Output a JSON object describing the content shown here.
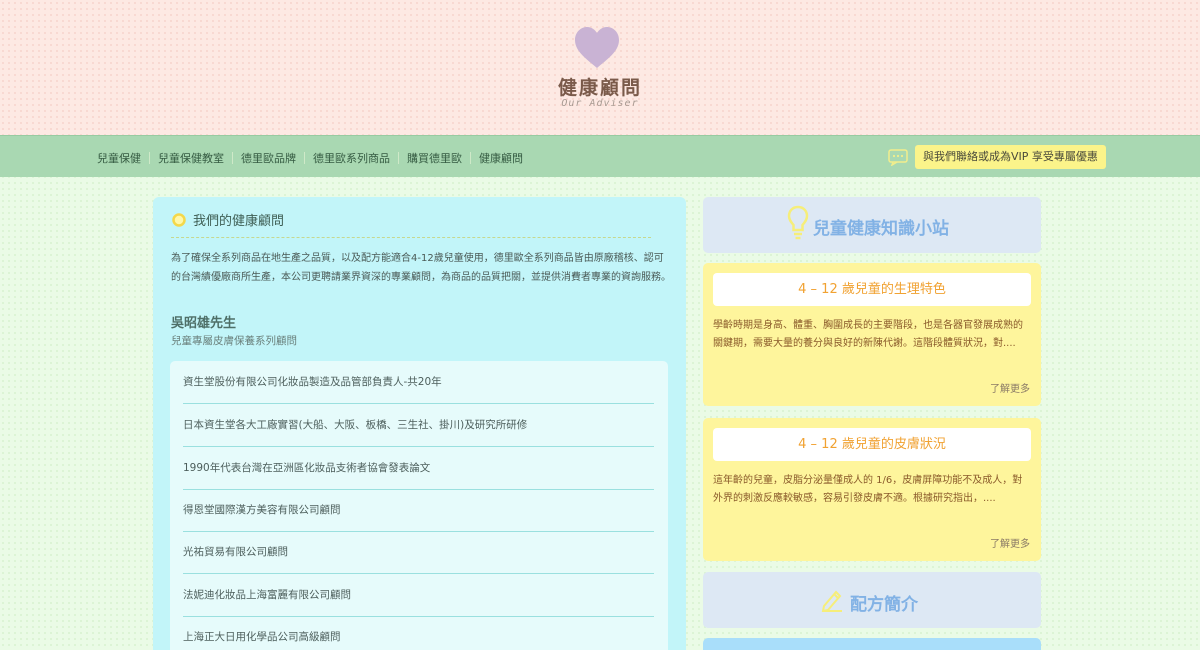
{
  "header": {
    "logo_icon": "heart-icon",
    "logo_color": "#c9b3d4",
    "title": "健康顧問",
    "subtitle": "Our Adviser"
  },
  "nav": {
    "items": [
      "兒童保健",
      "兒童保健教室",
      "德里歐品牌",
      "德里歐系列商品",
      "購買德里歐",
      "健康顧問"
    ],
    "chat_icon": "chat-bubble-icon",
    "vip_label": "與我們聯絡或成為VIP 享受專屬優惠"
  },
  "adviser": {
    "heading": "我們的健康顧問",
    "heading_icon": "yellow-circle-bullet-icon",
    "intro": "為了確保全系列商品在地生產之品質，以及配方能適合4-12歲兒童使用，德里歐全系列商品皆由原廠稽核、認可的台灣績優廠商所生產，本公司更聘請業界資深的專業顧問，為商品的品質把關，並提供消費者專業的資詢服務。",
    "name": "吳昭雄先生",
    "role": "兒童專屬皮膚保養系列顧問",
    "career": [
      "資生堂股份有限公司化妝品製造及品管部負責人-共20年",
      "日本資生堂各大工廠實習(大船、大阪、板橋、三生社、掛川)及研究所研修",
      "1990年代表台灣在亞洲區化妝品支術者協會發表論文",
      "得恩堂國際漢方美容有限公司顧問",
      "光祐貿易有限公司顧問",
      "法妮迪化妝品上海富麗有限公司顧問",
      "上海正大日用化學品公司高級顧問"
    ]
  },
  "knowledge": {
    "title": "兒童健康知識小站",
    "icon": "lightbulb-icon",
    "articles": [
      {
        "title": "4 – 12 歲兒童的生理特色",
        "excerpt": "學齡時期是身高、體重、胸圍成長的主要階段，也是各器官發展成熟的關鍵期，需要大量的養分與良好的新陳代謝。這階段體質狀況，對....",
        "more": "了解更多"
      },
      {
        "title": "4 – 12 歲兒童的皮膚狀況",
        "excerpt": "這年齡的兒童，皮脂分泌量僅成人的 1/6，皮膚屏障功能不及成人，對外界的刺激反應較敏感，容易引發皮膚不適。根據研究指出，....",
        "more": "了解更多"
      }
    ]
  },
  "formula": {
    "title": "配方簡介",
    "icon": "pencil-icon"
  },
  "colors": {
    "header_bg": "#fde9e3",
    "nav_bg": "#a9d8b2",
    "vip_bg": "#fbf48a",
    "left_panel_bg": "#c2f5f9",
    "card_bg": "#fef59c",
    "accent_orange": "#f1a232",
    "accent_blue": "#82b2e5"
  }
}
